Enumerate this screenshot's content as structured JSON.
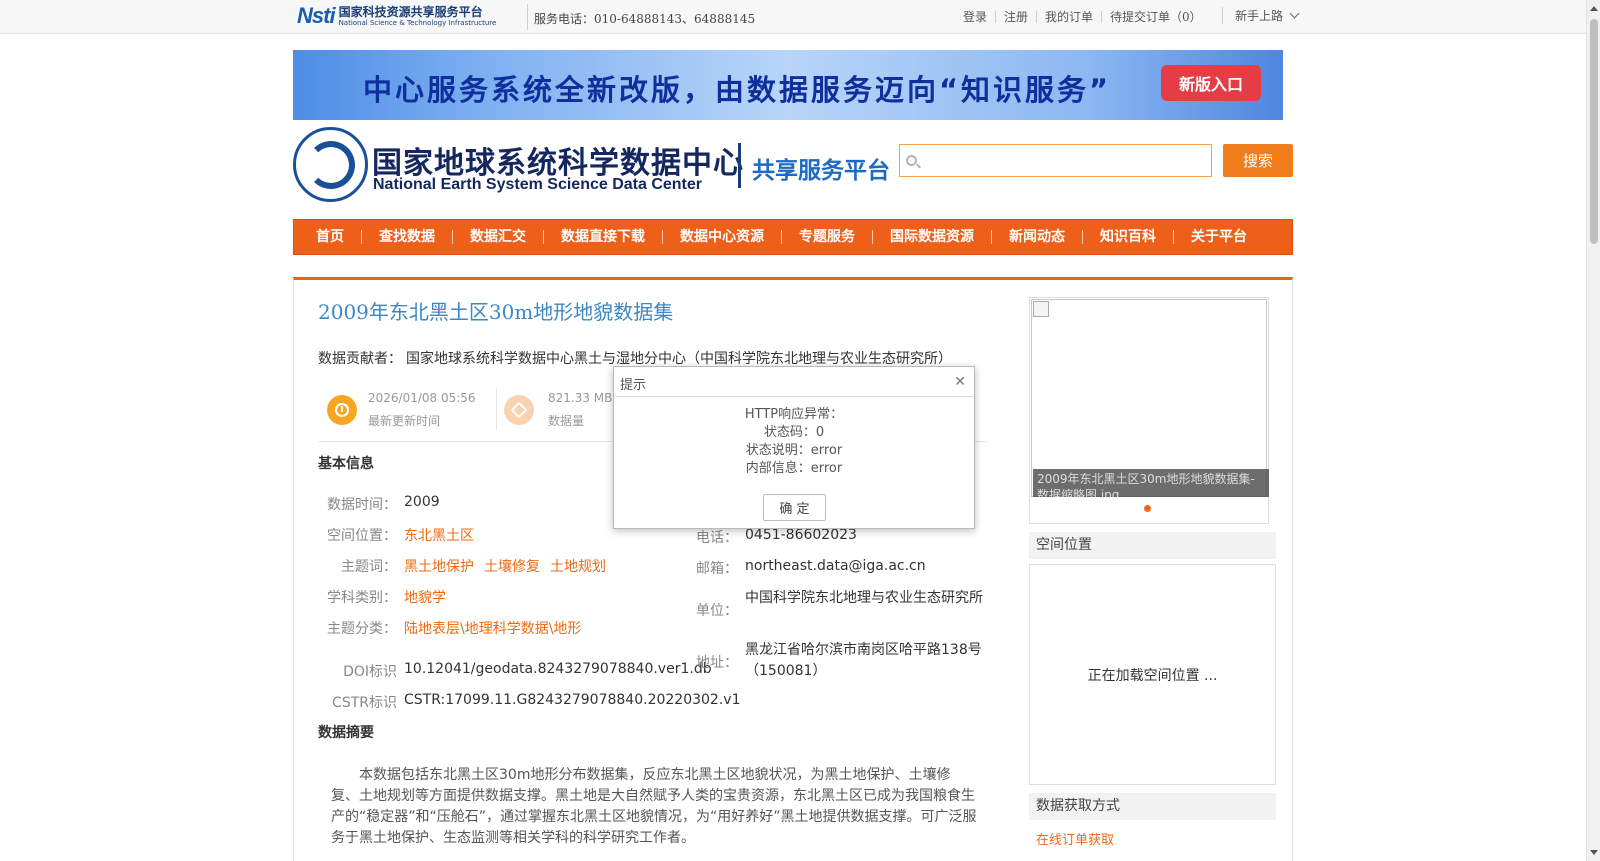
{
  "topbar": {
    "logo_mark": "Nsti",
    "logo_cn": "国家科技资源共享服务平台",
    "logo_en": "National Science & Technology Infrastructure",
    "phone": "服务电话：010-64888143、64888145",
    "links": [
      "登录",
      "注册",
      "我的订单",
      "待提交订单（0）"
    ],
    "guide": "新手上路"
  },
  "banner": {
    "text": "中心服务系统全新改版，由数据服务迈向“知识服务”",
    "button": "新版入口"
  },
  "header": {
    "logo_cn": "国家地球系统科学数据中心",
    "logo_en": "National Earth System Science Data Center",
    "platform": "共享服务平台",
    "search_placeholder": "",
    "search_button": "搜索"
  },
  "nav": [
    "首页",
    "查找数据",
    "数据汇交",
    "数据直接下载",
    "数据中心资源",
    "专题服务",
    "国际数据资源",
    "新闻动态",
    "知识百科",
    "关于平台"
  ],
  "dataset": {
    "title": "2009年东北黑土区30m地形地貌数据集",
    "contributor_label": "数据贡献者：",
    "contributor": "国家地球系统科学数据中心黑土与湿地分中心（中国科学院东北地理与农业生态研究所）",
    "updated": "2026/01/08 05:56",
    "updated_label": "最新更新时间",
    "size": "821.33 MB",
    "size_label": "数据量"
  },
  "basic": {
    "heading": "基本信息",
    "time_label": "数据时间：",
    "time": "2009",
    "space_label": "空间位置：",
    "space": "东北黑土区",
    "keywords_label": "主题词：",
    "keywords": [
      "黑土地保护",
      "土壤修复",
      "土地规划"
    ],
    "discipline_label": "学科类别：",
    "discipline": "地貌学",
    "category_label": "主题分类：",
    "category": "陆地表层\\地理科学数据\\地形",
    "doi_label": "DOI标识",
    "doi": "10.12041/geodata.8243279078840.ver1.db",
    "cstr_label": "CSTR标识",
    "cstr": "CSTR:17099.11.G8243279078840.20220302.v1",
    "phone_label": "电话：",
    "phone": "0451-86602023",
    "email_label": "邮箱：",
    "email": "northeast.data@iga.ac.cn",
    "unit_label": "单位：",
    "unit": "中国科学院东北地理与农业生态研究所",
    "address_label": "地址：",
    "address": "黑龙江省哈尔滨市南岗区哈平路138号（150081）"
  },
  "abstract": {
    "heading": "数据摘要",
    "text": "本数据包括东北黑土区30m地形分布数据集，反应东北黑土区地貌状况，为黑土地保护、土壤修复、土地规划等方面提供数据支撑。黑土地是大自然赋予人类的宝贵资源，东北黑土区已成为我国粮食生产的“稳定器”和“压舱石”，通过掌握东北黑土区地貌情况，为“用好养好”黑土地提供数据支撑。可广泛服务于黑土地保护、生态监测等相关学科的科学研究工作者。"
  },
  "sidebar": {
    "image_caption": "2009年东北黑土区30m地形地貌数据集-数据缩略图.jpg",
    "space_heading": "空间位置",
    "map_loading": "正在加载空间位置 ...",
    "access_heading": "数据获取方式",
    "access_link": "在线订单获取"
  },
  "modal": {
    "title": "提示",
    "lines": [
      "HTTP响应异常：",
      "状态码：0",
      "状态说明：error",
      "内部信息：error"
    ],
    "ok": "确 定"
  },
  "colors": {
    "accent": "#ee5f19",
    "link_orange": "#ee6a12",
    "title_blue": "#3a88c6"
  }
}
